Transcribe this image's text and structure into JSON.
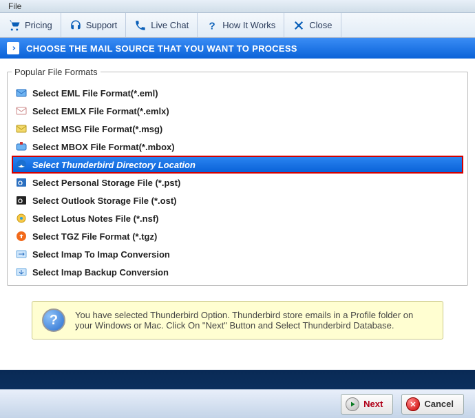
{
  "menu": {
    "file": "File"
  },
  "toolbar": {
    "pricing": "Pricing",
    "support": "Support",
    "livechat": "Live Chat",
    "howitworks": "How It Works",
    "close": "Close"
  },
  "banner": {
    "title": "CHOOSE THE MAIL SOURCE THAT YOU WANT TO PROCESS"
  },
  "formats": {
    "legend": "Popular File Formats",
    "items": [
      {
        "label": "Select EML File Format(*.eml)",
        "selected": false,
        "icon": "eml"
      },
      {
        "label": "Select EMLX File Format(*.emlx)",
        "selected": false,
        "icon": "emlx"
      },
      {
        "label": "Select MSG File Format(*.msg)",
        "selected": false,
        "icon": "msg"
      },
      {
        "label": "Select MBOX File Format(*.mbox)",
        "selected": false,
        "icon": "mbox"
      },
      {
        "label": "Select Thunderbird Directory Location",
        "selected": true,
        "icon": "tb"
      },
      {
        "label": "Select Personal Storage File (*.pst)",
        "selected": false,
        "icon": "pst"
      },
      {
        "label": "Select Outlook Storage File (*.ost)",
        "selected": false,
        "icon": "ost"
      },
      {
        "label": "Select Lotus Notes File (*.nsf)",
        "selected": false,
        "icon": "nsf"
      },
      {
        "label": "Select TGZ File Format (*.tgz)",
        "selected": false,
        "icon": "tgz"
      },
      {
        "label": "Select Imap To Imap Conversion",
        "selected": false,
        "icon": "imap"
      },
      {
        "label": "Select Imap Backup Conversion",
        "selected": false,
        "icon": "imapb"
      }
    ]
  },
  "info": {
    "text": "You have selected Thunderbird Option. Thunderbird store emails in a Profile folder on your Windows or Mac. Click On \"Next\" Button and Select Thunderbird Database."
  },
  "footer": {
    "next": "Next",
    "cancel": "Cancel"
  }
}
